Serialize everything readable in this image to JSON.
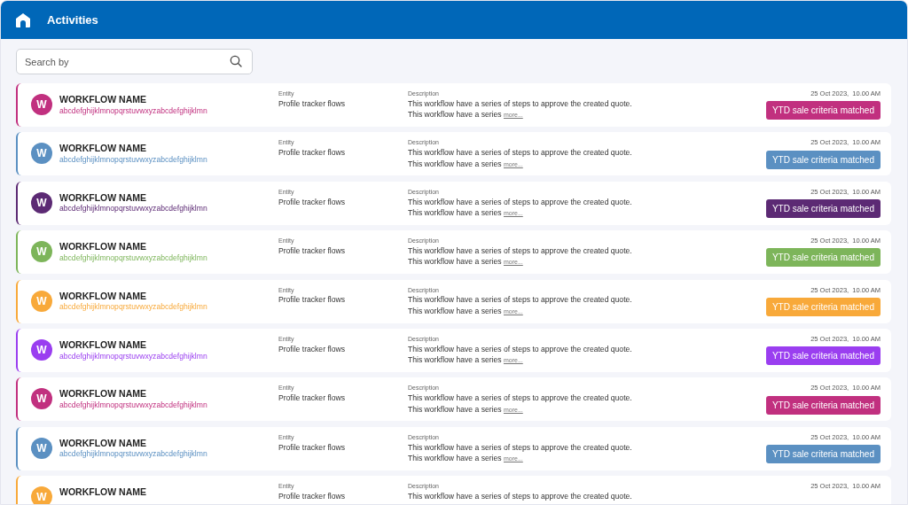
{
  "header": {
    "title": "Activities"
  },
  "search": {
    "placeholder": "Search by"
  },
  "activities": [
    {
      "initial": "W",
      "name": "WORKFLOW NAME",
      "subtitle": "abcdefghijklmnopqrstuvwxyzabcdefghijklmn",
      "color": "#c1307f",
      "entity_label": "Entity",
      "entity": "Profile tracker flows",
      "description_label": "Description",
      "description_lines": [
        "This workflow have a series of steps to approve the created quote.",
        "This workflow have a series"
      ],
      "more": "more...",
      "date": "25 Oct 2023,  10.00 AM",
      "badge": "YTD sale criteria matched"
    },
    {
      "initial": "W",
      "name": "WORKFLOW NAME",
      "subtitle": "abcdefghijklmnopqrstuvwxyzabcdefghijklmn",
      "color": "#5b90c2",
      "entity_label": "Entity",
      "entity": "Profile tracker flows",
      "description_label": "Description",
      "description_lines": [
        "This workflow have a series of steps to approve the created quote.",
        "This workflow have a series"
      ],
      "more": "more...",
      "date": "25 Oct 2023,  10.00 AM",
      "badge": "YTD sale criteria matched"
    },
    {
      "initial": "W",
      "name": "WORKFLOW NAME",
      "subtitle": "abcdefghijklmnopqrstuvwxyzabcdefghijklmn",
      "color": "#5c2a74",
      "entity_label": "Entity",
      "entity": "Profile tracker flows",
      "description_label": "Description",
      "description_lines": [
        "This workflow have a series of steps to approve the created quote.",
        "This workflow have a series"
      ],
      "more": "more...",
      "date": "25 Oct 2023,  10.00 AM",
      "badge": "YTD sale criteria matched"
    },
    {
      "initial": "W",
      "name": "WORKFLOW NAME",
      "subtitle": "abcdefghijklmnopqrstuvwxyzabcdefghijklmn",
      "color": "#7db55a",
      "entity_label": "Entity",
      "entity": "Profile tracker flows",
      "description_label": "Description",
      "description_lines": [
        "This workflow have a series of steps to approve the created quote.",
        "This workflow have a series"
      ],
      "more": "more...",
      "date": "25 Oct 2023,  10.00 AM",
      "badge": "YTD sale criteria matched"
    },
    {
      "initial": "W",
      "name": "WORKFLOW NAME",
      "subtitle": "abcdefghijklmnopqrstuvwxyzabcdefghijklmn",
      "color": "#f8a93a",
      "entity_label": "Entity",
      "entity": "Profile tracker flows",
      "description_label": "Description",
      "description_lines": [
        "This workflow have a series of steps to approve the created quote.",
        "This workflow have a series"
      ],
      "more": "more...",
      "date": "25 Oct 2023,  10.00 AM",
      "badge": "YTD sale criteria matched"
    },
    {
      "initial": "W",
      "name": "WORKFLOW NAME",
      "subtitle": "abcdefghijklmnopqrstuvwxyzabcdefghijklmn",
      "color": "#9a3ef0",
      "entity_label": "Entity",
      "entity": "Profile tracker flows",
      "description_label": "Description",
      "description_lines": [
        "This workflow have a series of steps to approve the created quote.",
        "This workflow have a series"
      ],
      "more": "more...",
      "date": "25 Oct 2023,  10.00 AM",
      "badge": "YTD sale criteria matched"
    },
    {
      "initial": "W",
      "name": "WORKFLOW NAME",
      "subtitle": "abcdefghijklmnopqrstuvwxyzabcdefghijklmn",
      "color": "#c1307f",
      "entity_label": "Entity",
      "entity": "Profile tracker flows",
      "description_label": "Description",
      "description_lines": [
        "This workflow have a series of steps to approve the created quote.",
        "This workflow have a series"
      ],
      "more": "more...",
      "date": "25 Oct 2023,  10.00 AM",
      "badge": "YTD sale criteria matched"
    },
    {
      "initial": "W",
      "name": "WORKFLOW NAME",
      "subtitle": "abcdefghijklmnopqrstuvwxyzabcdefghijklmn",
      "color": "#5b90c2",
      "entity_label": "Entity",
      "entity": "Profile tracker flows",
      "description_label": "Description",
      "description_lines": [
        "This workflow have a series of steps to approve the created quote.",
        "This workflow have a series"
      ],
      "more": "more...",
      "date": "25 Oct 2023,  10.00 AM",
      "badge": "YTD sale criteria matched"
    },
    {
      "initial": "W",
      "name": "WORKFLOW NAME",
      "color": "#f8a93a",
      "entity_label": "Entity",
      "entity": "Profile tracker flows",
      "description_label": "Description",
      "description_lines": [
        "This workflow have a series of steps to approve the created quote."
      ],
      "date": "25 Oct 2023,  10.00 AM"
    }
  ]
}
